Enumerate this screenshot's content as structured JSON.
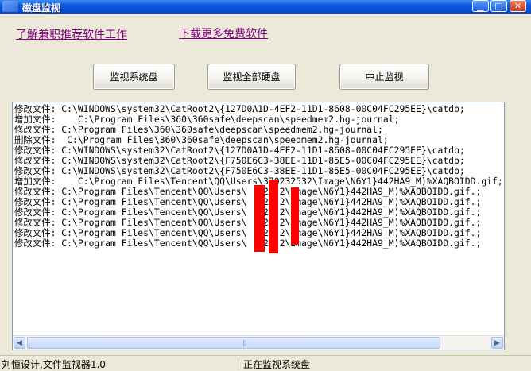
{
  "window": {
    "title": "磁盘监视",
    "controls": {
      "minimize": "▁",
      "maximize": "□",
      "close": "✕"
    }
  },
  "links": {
    "parttime": "了解兼职推荐软件工作",
    "download": "下载更多免费软件"
  },
  "buttons": {
    "monitor_system": "监视系统盘",
    "monitor_all": "监视全部硬盘",
    "stop": "中止监视"
  },
  "log": [
    "修改文件: C:\\WINDOWS\\system32\\CatRoot2\\{127D0A1D-4EF2-11D1-8608-00C04FC295EE}\\catdb;",
    "增加文件:    C:\\Program Files\\360\\360safe\\deepscan\\speedmem2.hg-journal;",
    "修改文件: C:\\Program Files\\360\\360safe\\deepscan\\speedmem2.hg-journal;",
    "删除文件:  C:\\Program Files\\360\\360safe\\deepscan\\speedmem2.hg-journal;",
    "修改文件: C:\\WINDOWS\\system32\\CatRoot2\\{127D0A1D-4EF2-11D1-8608-00C04FC295EE}\\catdb;",
    "修改文件: C:\\WINDOWS\\system32\\CatRoot2\\{F750E6C3-38EE-11D1-85E5-00C04FC295EE}\\catdb;",
    "修改文件: C:\\WINDOWS\\system32\\CatRoot2\\{F750E6C3-38EE-11D1-85E5-00C04FC295EE}\\catdb;",
    "增加文件:    C:\\Program Files\\Tencent\\QQ\\Users\\370232532\\Image\\N6Y1}442HA9_M)%XAQBOIDD.gif;",
    "修改文件: C:\\Program Files\\Tencent\\QQ\\Users\\  32  2\\Image\\N6Y1}442HA9_M)%XAQBOIDD.gif.;",
    "修改文件: C:\\Program Files\\Tencent\\QQ\\Users\\  32  2\\Image\\N6Y1}442HA9_M)%XAQBOIDD.gif.;",
    "修改文件: C:\\Program Files\\Tencent\\QQ\\Users\\  32  2\\Image\\N6Y1}442HA9_M)%XAQBOIDD.gif.;",
    "修改文件: C:\\Program Files\\Tencent\\QQ\\Users\\  32  2\\Image\\N6Y1}442HA9_M)%XAQBOIDD.gif.;",
    "修改文件: C:\\Program Files\\Tencent\\QQ\\Users\\  32  2\\Image\\N6Y1}442HA9_M)%XAQBOIDD.gif.;",
    "修改文件: C:\\Program Files\\Tencent\\QQ\\Users\\  32  2\\Image\\N6Y1}442HA9_M)%XAQBOIDD.gif.;"
  ],
  "scrollbar": {
    "left_arrow": "◀",
    "right_arrow": "▶",
    "grip": "|||"
  },
  "status": {
    "left": "刘恒设计,文件监视器1.0",
    "right": "正在监视系统盘"
  },
  "colors": {
    "title_bar": "#0a58df",
    "link": "#800080",
    "redaction": "#ff0000",
    "window_bg": "#ece9d8"
  }
}
